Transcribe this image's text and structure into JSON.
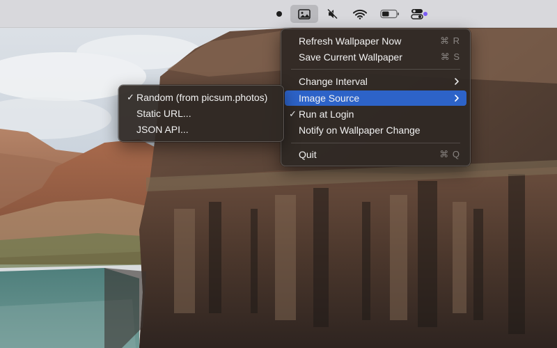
{
  "menubar": {
    "status_icons": [
      {
        "name": "dot-indicator",
        "icon": "filled-circle"
      },
      {
        "name": "wallpaper-app",
        "icon": "image-icon",
        "active": true
      },
      {
        "name": "sound",
        "icon": "speaker-muted-icon"
      },
      {
        "name": "wifi",
        "icon": "wifi-icon"
      },
      {
        "name": "battery",
        "icon": "battery-icon",
        "level": 0.5
      },
      {
        "name": "control-center",
        "icon": "toggle-switches-icon",
        "badge_color": "#7b5cf5"
      }
    ]
  },
  "main_menu": {
    "items": [
      {
        "label": "Refresh Wallpaper Now",
        "shortcut": "⌘ R"
      },
      {
        "label": "Save Current Wallpaper",
        "shortcut": "⌘ S"
      },
      {
        "label": "Change Interval",
        "submenu": true
      },
      {
        "label": "Image Source",
        "submenu": true,
        "highlighted": true
      },
      {
        "label": "Run at Login",
        "checked": true
      },
      {
        "label": "Notify on Wallpaper Change"
      },
      {
        "label": "Quit",
        "shortcut": "⌘ Q"
      }
    ]
  },
  "image_source_submenu": {
    "items": [
      {
        "label": "Random (from picsum.photos)",
        "checked": true
      },
      {
        "label": "Static URL..."
      },
      {
        "label": "JSON API..."
      }
    ]
  },
  "colors": {
    "highlight": "#2d63c8",
    "menu_bg": "#2e2824",
    "menubar_bg": "#d8d8dc"
  }
}
